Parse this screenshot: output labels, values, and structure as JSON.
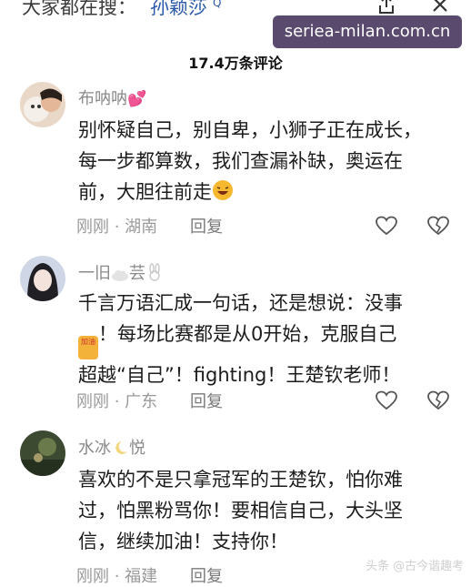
{
  "search": {
    "prefix": "大家都在搜：",
    "term": "孙颖莎",
    "q_marker": "Q"
  },
  "watermark": "seriea-milan.com.cn",
  "comment_count": "17.4万条评论",
  "comments": [
    {
      "username": "布呐呐",
      "username_deco": "💕",
      "text_lines": [
        "别怀疑自己，别自卑，小狮子正在成长，",
        "每一步都算数，我们查漏补缺，奥运在",
        "前，大胆往前走"
      ],
      "time": "刚刚",
      "location": "湖南",
      "reply": "回复"
    },
    {
      "username_a": "一旧",
      "username_b": "芸",
      "text_lines": [
        "千言万语汇成一句话，还是想说：没事",
        "！每场比赛都是从0开始，克服自己",
        "超越“自己”！fighting！王楚钦老师！"
      ],
      "badge": "加油",
      "time": "刚刚",
      "location": "广东",
      "reply": "回复"
    },
    {
      "username_a": "水冰",
      "username_b": "悦",
      "text_lines": [
        "喜欢的不是只拿冠军的王楚钦，怕你难",
        "过，怕黑粉骂你！要相信自己，大头坚",
        "信，继续加油！支持你！"
      ],
      "time": "刚刚",
      "location": "福建",
      "reply": "回复"
    }
  ],
  "corner_watermark": "头条 @古今谐趣考",
  "colors": {
    "link": "#2b5aa8",
    "meta": "#9a9a9a",
    "watermark_bg": "#5a4a6e"
  },
  "icons": [
    "share-icon",
    "close-icon",
    "like-heart-icon",
    "broken-heart-icon"
  ]
}
